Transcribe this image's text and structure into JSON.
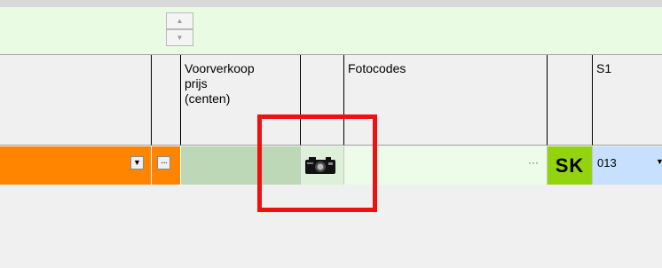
{
  "spinner": {
    "up_arrow": "▲",
    "down_arrow": "▼",
    "icons": [
      "chevron-up-icon",
      "chevron-down-icon"
    ]
  },
  "columns": [
    {
      "key": "dropdown_col",
      "header": ""
    },
    {
      "key": "ellipsis_col",
      "header": ""
    },
    {
      "key": "price",
      "header": "Voorverkoop\nprijs\n(centen)"
    },
    {
      "key": "photo",
      "header": ""
    },
    {
      "key": "fotocodes",
      "header": "Fotocodes"
    },
    {
      "key": "sk",
      "header": ""
    },
    {
      "key": "s1",
      "header": "S1"
    }
  ],
  "row": {
    "dropdown_arrow": "▼",
    "ellipsis": "···",
    "photo_icon": "camera-icon",
    "fotocodes_ellipsis": "···",
    "sk_label": "SK",
    "s1_value": "013",
    "s1_arrow": "▼"
  },
  "colors": {
    "orange": "#ff8400",
    "sk_green": "#93d40f",
    "s1_blue": "#c7e0fd",
    "highlight_red": "#ee1111"
  }
}
